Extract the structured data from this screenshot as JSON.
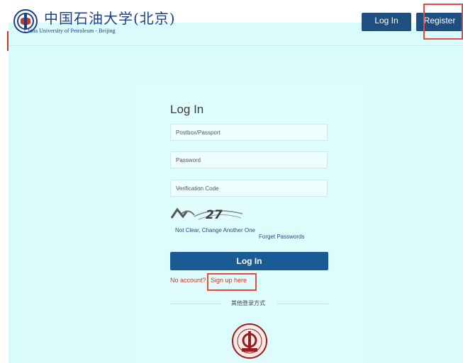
{
  "header": {
    "logo_cn": "中国石油大学(北京)",
    "logo_en": "China University of Petroleum - Beijing",
    "login_label": "Log In",
    "register_label": "Register"
  },
  "form": {
    "title": "Log In",
    "postbox_placeholder": "Postbox/Passport",
    "password_placeholder": "Password",
    "verification_placeholder": "Verification Code",
    "captcha_text": "27",
    "refresh_captcha": "Not Clear, Change Another One",
    "forget_passwords": "Forget Passwords",
    "submit_label": "Log In",
    "no_account": "No account?",
    "sign_up": "Sign up here",
    "other_login": "其他登录方式"
  },
  "colors": {
    "accent": "#1f4f80",
    "page_background": "#d9fbfb",
    "highlight": "#e54b3c",
    "link_red": "#c0392b"
  },
  "icons": {
    "logo": "university-emblem-icon",
    "seal": "university-seal-icon"
  }
}
